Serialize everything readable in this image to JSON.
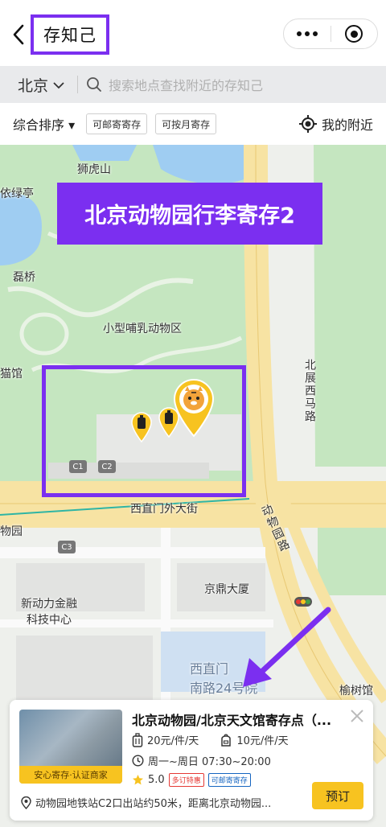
{
  "header": {
    "title": "存知己"
  },
  "search": {
    "city": "北京",
    "placeholder": "搜索地点查找附近的存知己"
  },
  "filters": {
    "sort": "综合排序 ▾",
    "chip_mail": "可邮寄寄存",
    "chip_monthly": "可按月寄存",
    "nearby": "我的附近"
  },
  "map": {
    "banner": "北京动物园行李寄存2",
    "labels": {
      "shihushan": "狮虎山",
      "yilvting": "依绿亭",
      "leiqiao": "磊桥",
      "small_mammal": "小型哺乳动物区",
      "maoguan": "猫馆",
      "beizhan_xi_malu": "北展西马路",
      "xizhimen_wai": "西直门外大街",
      "dongwuyuan_lu": "动物园路",
      "dongwuyuan_short": "物园",
      "xinmao": "新动力金融\n科技中心",
      "jingding": "京鼎大厦",
      "xizhimen_nan": "西直门\n南路24号院",
      "yushu": "榆树馆"
    },
    "stations": [
      "C1",
      "C2",
      "C3"
    ],
    "colors": {
      "park": "#c5e6c0",
      "water": "#9fcdf2",
      "road": "#f7e3a3",
      "highlight": "#7b2ff0",
      "pin": "#f7c320"
    }
  },
  "card": {
    "title": "北京动物园/北京天文馆寄存点（...",
    "badge": "安心寄存·认证商家",
    "price_large": "20元/件/天",
    "price_small": "10元/件/天",
    "hours": "周一~周日 07:30~20:00",
    "rating": "5.0",
    "tag_discount": "多订特惠",
    "tag_mail": "可邮寄寄存",
    "address": "动物园地铁站C2口出站约50米，距离北京动物园...",
    "book": "预订"
  }
}
